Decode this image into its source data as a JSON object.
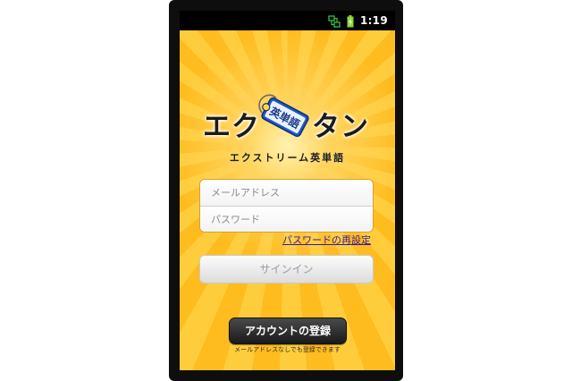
{
  "status_bar": {
    "time": "1:19",
    "icons": [
      "network-sync-icon",
      "battery-charging-icon"
    ]
  },
  "app": {
    "logo_left": "エク",
    "logo_right": "タン",
    "tag_text": "英単語",
    "subtitle": "エクストリーム英単語"
  },
  "login": {
    "email_placeholder": "メールアドレス",
    "password_placeholder": "パスワード",
    "reset_password_label": "パスワードの再設定",
    "signin_label": "サインイン"
  },
  "register": {
    "button_label": "アカウントの登録",
    "note": "メールアドレスなしでも登録できます"
  },
  "colors": {
    "background_ray_light": "#ffcd3c",
    "background_ray_dark": "#ffbc1f",
    "link": "#3a1aa0",
    "register_button": "#2a2a2a"
  }
}
